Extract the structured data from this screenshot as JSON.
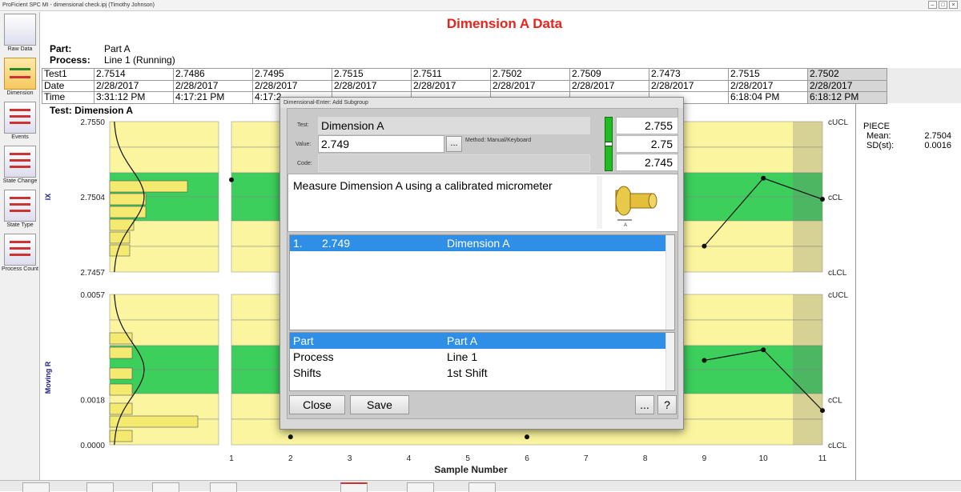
{
  "app": {
    "title": "ProFicient SPC MI - dimensional check.ipj (Timothy Johnson)"
  },
  "sidebar": {
    "items": [
      {
        "label": "Raw Data",
        "icon": "raw-data-icon"
      },
      {
        "label": "Dimension",
        "icon": "dimension-icon"
      },
      {
        "label": "Events",
        "icon": "events-icon"
      },
      {
        "label": "State Change",
        "icon": "state-change-icon"
      },
      {
        "label": "State Type",
        "icon": "state-type-icon"
      },
      {
        "label": "Process Count",
        "icon": "process-count-icon"
      }
    ]
  },
  "page": {
    "title": "Dimension A Data",
    "part_label": "Part:",
    "part_value": "Part A",
    "process_label": "Process:",
    "process_value": "Line 1 (Running)",
    "test_label": "Test: Dimension A"
  },
  "grid": {
    "headers": [
      "Test1",
      "Date",
      "Time"
    ],
    "test1": [
      "2.7514",
      "2.7486",
      "2.7495",
      "2.7515",
      "2.7511",
      "2.7502",
      "2.7509",
      "2.7473",
      "2.7515",
      "2.7502"
    ],
    "date": [
      "2/28/2017",
      "2/28/2017",
      "2/28/2017",
      "2/28/2017",
      "2/28/2017",
      "2/28/2017",
      "2/28/2017",
      "2/28/2017",
      "2/28/2017",
      "2/28/2017"
    ],
    "time": [
      "3:31:12 PM",
      "4:17:21 PM",
      "4:17:2",
      "",
      "",
      "",
      "",
      "",
      "6:18:04 PM",
      "6:18:12 PM"
    ]
  },
  "chart_data": [
    {
      "type": "line",
      "ylabel": "IX",
      "yticks": [
        "2.7550",
        "2.7504",
        "2.7457"
      ],
      "limit_labels": [
        "cUCL",
        "cCL",
        "cLCL"
      ],
      "x": [
        1,
        2,
        3,
        4,
        5,
        6,
        7,
        8,
        9,
        10,
        11
      ],
      "values": [
        2.7514,
        null,
        null,
        null,
        null,
        null,
        null,
        null,
        2.7473,
        2.7515,
        2.7502
      ],
      "ylim": [
        2.7457,
        2.755
      ]
    },
    {
      "type": "line",
      "ylabel": "Moving R",
      "yticks": [
        "0.0057",
        "0.0018",
        "0.0000"
      ],
      "limit_labels": [
        "cUCL",
        "cCL",
        "cLCL"
      ],
      "x": [
        1,
        2,
        3,
        4,
        5,
        6,
        7,
        8,
        9,
        10,
        11
      ],
      "values": [
        null,
        0.0003,
        null,
        null,
        null,
        0.0003,
        null,
        null,
        0.0032,
        0.0036,
        0.0013
      ],
      "ylim": [
        0,
        0.0057
      ],
      "xlabel": "Sample Number",
      "xticks": [
        "1",
        "2",
        "3",
        "4",
        "5",
        "6",
        "7",
        "8",
        "9",
        "10",
        "11"
      ]
    }
  ],
  "stats": {
    "title": "PIECE",
    "mean_label": "Mean:",
    "mean_value": "2.7504",
    "sd_label": "SD(st):",
    "sd_value": "0.0016"
  },
  "dialog": {
    "title": "Dimensional-Enter: Add Subgroup",
    "test_label": "Test:",
    "test_value": "Dimension A",
    "value_label": "Value:",
    "value_input": "2.749",
    "browse_label": "...",
    "method": "Method: Manual/Keyboard",
    "code_label": "Code:",
    "limits": [
      "2.755",
      "2.75",
      "2.745"
    ],
    "description": "Measure Dimension A using a calibrated micrometer",
    "entries": [
      {
        "num": "1.",
        "value": "2.749",
        "name": "Dimension A"
      }
    ],
    "descriptors": [
      {
        "label": "Part",
        "value": "Part A"
      },
      {
        "label": "Process",
        "value": "Line 1"
      },
      {
        "label": "Shifts",
        "value": "1st Shift"
      }
    ],
    "close_label": "Close",
    "save_label": "Save",
    "more_label": "...",
    "help_label": "?"
  },
  "colors": {
    "accent_red": "#e8231c",
    "zone_green": "#3ccf5c",
    "zone_yellow": "#fbf59f",
    "selection": "#2f8fe6"
  }
}
